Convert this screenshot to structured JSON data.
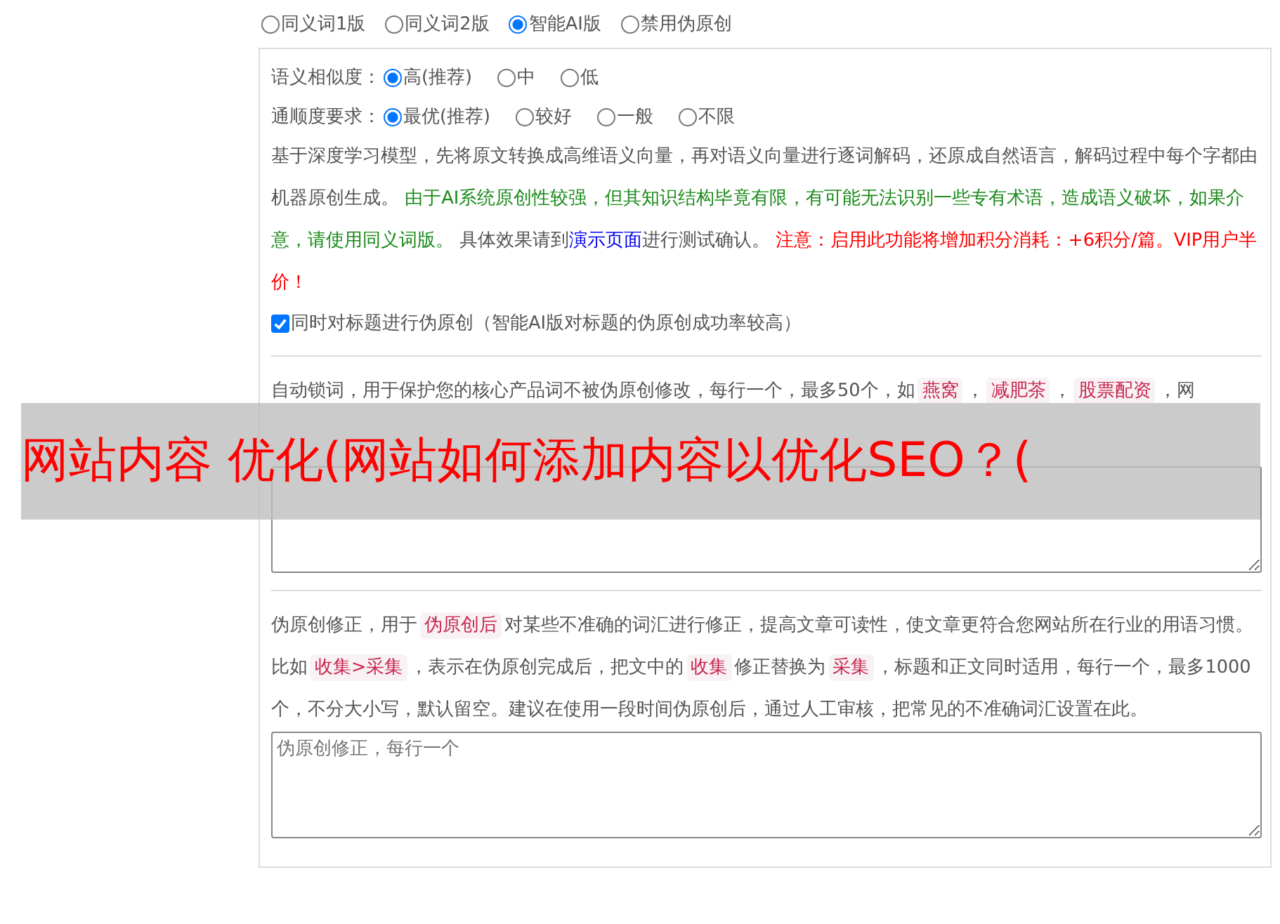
{
  "modes": [
    {
      "label": "同义词1版",
      "selected": false
    },
    {
      "label": "同义词2版",
      "selected": false
    },
    {
      "label": "智能AI版",
      "selected": true
    },
    {
      "label": "禁用伪原创",
      "selected": false
    }
  ],
  "ai_settings": {
    "similarity": {
      "label": "语义相似度：",
      "options": [
        {
          "label": "高(推荐)",
          "selected": true
        },
        {
          "label": "中",
          "selected": false
        },
        {
          "label": "低",
          "selected": false
        }
      ]
    },
    "fluency": {
      "label": "通顺度要求：",
      "options": [
        {
          "label": "最优(推荐)",
          "selected": true
        },
        {
          "label": "较好",
          "selected": false
        },
        {
          "label": "一般",
          "selected": false
        },
        {
          "label": "不限",
          "selected": false
        }
      ]
    },
    "description": [
      {
        "kind": "plain",
        "text": "基于深度学习模型，先将原文转换成高维语义向量，再对语义向量进行逐词解码，还原成自然语言，解码过程中每个字都由机器原创生成。 "
      },
      {
        "kind": "note",
        "text": "由于AI系统原创性较强，但其知识结构毕竟有限，有可能无法识别一些专有术语，造成语义破坏，如果介意，请使用同义词版。"
      },
      {
        "kind": "plain",
        "text": " 具体效果请到"
      },
      {
        "kind": "link",
        "text": "演示页面"
      },
      {
        "kind": "plain",
        "text": "进行测试确认。 "
      },
      {
        "kind": "warning",
        "text": "注意：启用此功能将增加积分消耗：+6积分/篇。VIP用户半价！"
      }
    ],
    "title_option": {
      "label": "同时对标题进行伪原创（智能AI版对标题的伪原创成功率较高）",
      "checked": true
    }
  },
  "lock_words": {
    "description": [
      {
        "kind": "plain",
        "text": "自动锁词，用于保护您的核心产品词不被伪原创修改，每行一个，最多50个，如"
      },
      {
        "kind": "tag",
        "text": "燕窝"
      },
      {
        "kind": "plain",
        "text": "，"
      },
      {
        "kind": "tag",
        "text": "减肥茶"
      },
      {
        "kind": "plain",
        "text": "，"
      },
      {
        "kind": "tag",
        "text": "股票配资"
      },
      {
        "kind": "plain",
        "text": "，网"
      }
    ]
  },
  "banner": {
    "text": "网站内容 优化(网站如何添加内容以优化SEO？("
  },
  "correction": {
    "description": [
      {
        "kind": "plain",
        "text": "伪原创修正，用于"
      },
      {
        "kind": "tag",
        "text": "伪原创后"
      },
      {
        "kind": "plain",
        "text": "对某些不准确的词汇进行修正，提高文章可读性，使文章更符合您网站所在行业的用语习惯。比如"
      },
      {
        "kind": "tag",
        "text": "收集>采集"
      },
      {
        "kind": "plain",
        "text": "，表示在伪原创完成后，把文中的"
      },
      {
        "kind": "tag",
        "text": "收集"
      },
      {
        "kind": "plain",
        "text": "修正替换为"
      },
      {
        "kind": "tag",
        "text": "采集"
      },
      {
        "kind": "plain",
        "text": "，标题和正文同时适用，每行一个，最多1000个，不分大小写，默认留空。建议在使用一段时间伪原创后，通过人工审核，把常见的不准确词汇设置在此。"
      }
    ],
    "placeholder": "伪原创修正，每行一个"
  }
}
